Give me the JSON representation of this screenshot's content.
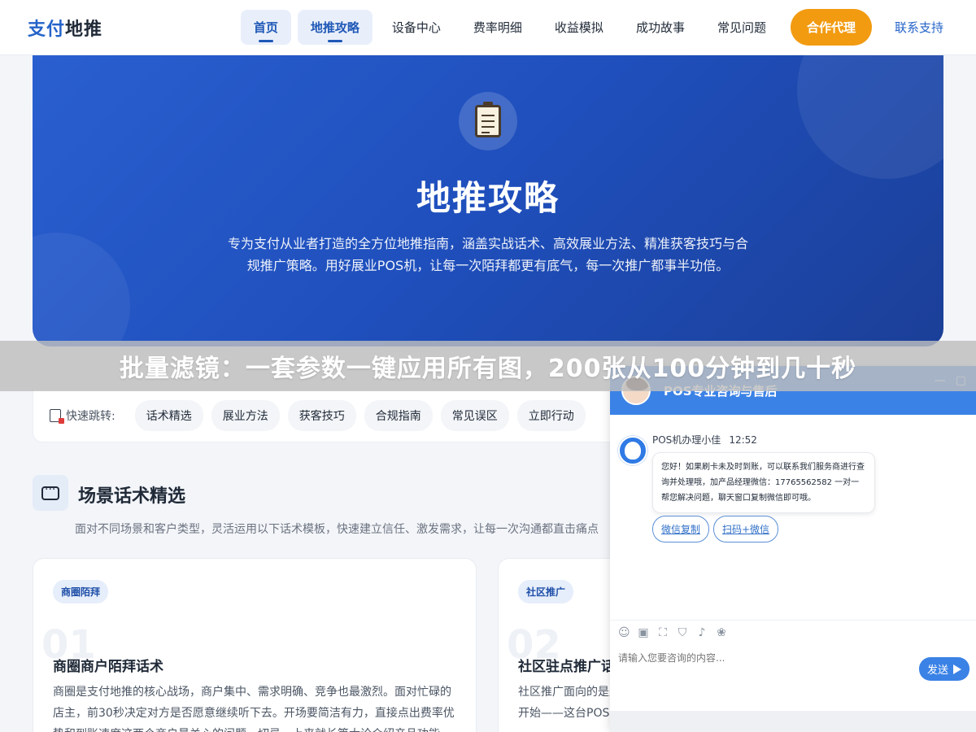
{
  "header": {
    "logo_highlight": "支付",
    "logo_rest": "地推",
    "nav": [
      {
        "label": "首页",
        "active": true
      },
      {
        "label": "地推攻略",
        "active": true
      },
      {
        "label": "设备中心",
        "active": false
      },
      {
        "label": "费率明细",
        "active": false
      },
      {
        "label": "收益模拟",
        "active": false
      },
      {
        "label": "成功故事",
        "active": false
      },
      {
        "label": "常见问题",
        "active": false
      }
    ],
    "cta": "合作代理",
    "contact": "联系支持"
  },
  "hero": {
    "icon": "clipboard-icon",
    "title": "地推攻略",
    "description": "专为支付从业者打造的全方位地推指南，涵盖实战话术、高效展业方法、精准获客技巧与合规推广策略。用好展业POS机，让每一次陌拜都更有底气，每一次推广都事半功倍。"
  },
  "overlay_banner": "批量滤镜：一套参数一键应用所有图，200张从100分钟到几十秒",
  "quick_jump": {
    "label": "快速跳转:",
    "items": [
      "话术精选",
      "展业方法",
      "获客技巧",
      "合规指南",
      "常见误区",
      "立即行动"
    ]
  },
  "section": {
    "title": "场景话术精选",
    "subtitle": "面对不同场景和客户类型，灵活运用以下话术模板，快速建立信任、激发需求，让每一次沟通都直击痛点"
  },
  "cards": [
    {
      "tag": "商圈陌拜",
      "num": "01",
      "title": "商圈商户陌拜话术",
      "body": "商圈是支付地推的核心战场，商户集中、需求明确、竞争也最激烈。面对忙碌的店主，前30秒决定对方是否愿意继续听下去。开场要简洁有力，直接点出费率优势和到账速度这两个商户最关心的问题，切忌一上来就长篇大论介绍产品功能。"
    },
    {
      "tag": "社区推广",
      "num": "02",
      "title": "社区驻点推广话术",
      "body": "社区推广面向的是周边小店和个体商户，社区驻点时，亲和力最重要，先从寒暄开始——这台POS机安装方便。"
    }
  ],
  "chat": {
    "title": "POS专业咨询与售后",
    "controls": [
      "—",
      "▢"
    ],
    "agent_name": "POS机办理小佳",
    "time": "12:52",
    "message": "您好！如果刷卡未及时到账，可以联系我们服务商进行查询并处理哦，加产品经理微信：17765562582 一对一帮您解决问题，聊天窗口复制微信即可哦。",
    "quick_buttons": [
      "微信复制",
      "扫码+微信"
    ],
    "tool_icons": [
      "smile-icon",
      "image-icon",
      "screenshot-icon",
      "shield-icon",
      "mute-icon",
      "wechat-icon"
    ],
    "input_placeholder": "请输入您要咨询的内容...",
    "send_label": "发送"
  }
}
